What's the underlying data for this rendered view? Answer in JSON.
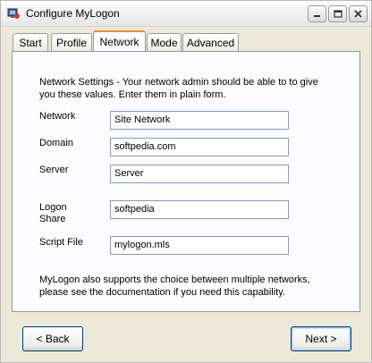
{
  "window": {
    "title": "Configure MyLogon"
  },
  "tabs": [
    {
      "label": "Start"
    },
    {
      "label": "Profile"
    },
    {
      "label": "Network",
      "active": true
    },
    {
      "label": "Mode"
    },
    {
      "label": "Advanced"
    }
  ],
  "network_tab": {
    "intro_text": "Network Settings - Your network admin should be able to to give you these values. Enter them in plain form.",
    "fields": {
      "network": {
        "label": "Network",
        "value": "Site Network"
      },
      "domain": {
        "label": "Domain",
        "value": "softpedia.com"
      },
      "server": {
        "label": "Server",
        "value": "Server"
      },
      "logon_share": {
        "label": "Logon Share",
        "value": "softpedia"
      },
      "script_file": {
        "label": "Script File",
        "value": "mylogon.mls"
      }
    },
    "footer_text": "MyLogon also supports the choice between multiple networks, please see the documentation if you need this capability."
  },
  "buttons": {
    "back": "< Back",
    "next": "Next >"
  },
  "colors": {
    "active_tab_accent": "#e68b2c",
    "focus_border": "#7f9db9",
    "dialog_background": "#ece9d8"
  }
}
